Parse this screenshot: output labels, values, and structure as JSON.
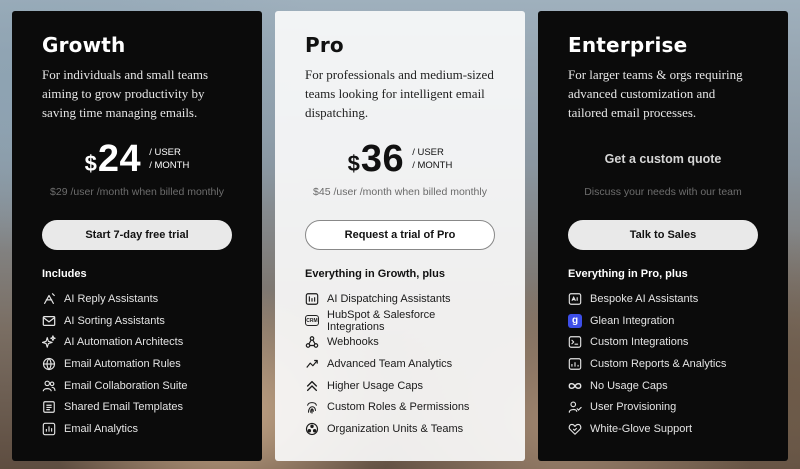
{
  "plans": [
    {
      "name": "Growth",
      "description": "For individuals and small teams aiming to grow productivity by saving time managing emails.",
      "currency": "$",
      "price": "24",
      "unit_line1": "/ USER",
      "unit_line2": "/ MONTH",
      "billing_note": "$29 /user /month when billed monthly",
      "cta": "Start 7-day free trial",
      "includes_title": "Includes",
      "features": [
        {
          "label": "AI Reply Assistants",
          "icon": "reply-assistant-icon"
        },
        {
          "label": "AI Sorting Assistants",
          "icon": "envelope-sort-icon"
        },
        {
          "label": "AI Automation Architects",
          "icon": "sparkles-icon"
        },
        {
          "label": "Email Automation Rules",
          "icon": "globe-rules-icon"
        },
        {
          "label": "Email Collaboration Suite",
          "icon": "users-icon"
        },
        {
          "label": "Shared Email Templates",
          "icon": "template-icon"
        },
        {
          "label": "Email Analytics",
          "icon": "analytics-icon"
        }
      ]
    },
    {
      "name": "Pro",
      "description": "For professionals and medium-sized teams looking for intelligent email dispatching.",
      "currency": "$",
      "price": "36",
      "unit_line1": "/ USER",
      "unit_line2": "/ MONTH",
      "billing_note": "$45 /user /month when billed monthly",
      "cta": "Request a trial of Pro",
      "includes_title": "Everything in Growth, plus",
      "features": [
        {
          "label": "AI Dispatching Assistants",
          "icon": "dispatch-icon"
        },
        {
          "label": "HubSpot & Salesforce Integrations",
          "icon": "crm-icon"
        },
        {
          "label": "Webhooks",
          "icon": "webhook-icon"
        },
        {
          "label": "Advanced Team Analytics",
          "icon": "team-analytics-icon"
        },
        {
          "label": "Higher Usage Caps",
          "icon": "chevrons-up-icon"
        },
        {
          "label": "Custom Roles & Permissions",
          "icon": "fingerprint-icon"
        },
        {
          "label": "Organization Units & Teams",
          "icon": "org-units-icon"
        }
      ]
    },
    {
      "name": "Enterprise",
      "description": "For larger teams & orgs requiring advanced customization and tailored email processes.",
      "custom_quote": "Get a custom quote",
      "billing_note": "Discuss your needs with our team",
      "cta": "Talk to Sales",
      "includes_title": "Everything in Pro, plus",
      "features": [
        {
          "label": "Bespoke AI Assistants",
          "icon": "bespoke-icon"
        },
        {
          "label": "Glean Integration",
          "icon": "glean-logo-icon"
        },
        {
          "label": "Custom Integrations",
          "icon": "terminal-icon"
        },
        {
          "label": "Custom Reports & Analytics",
          "icon": "report-icon"
        },
        {
          "label": "No Usage Caps",
          "icon": "infinity-icon"
        },
        {
          "label": "User Provisioning",
          "icon": "user-check-icon"
        },
        {
          "label": "White-Glove Support",
          "icon": "heart-support-icon"
        }
      ]
    }
  ]
}
